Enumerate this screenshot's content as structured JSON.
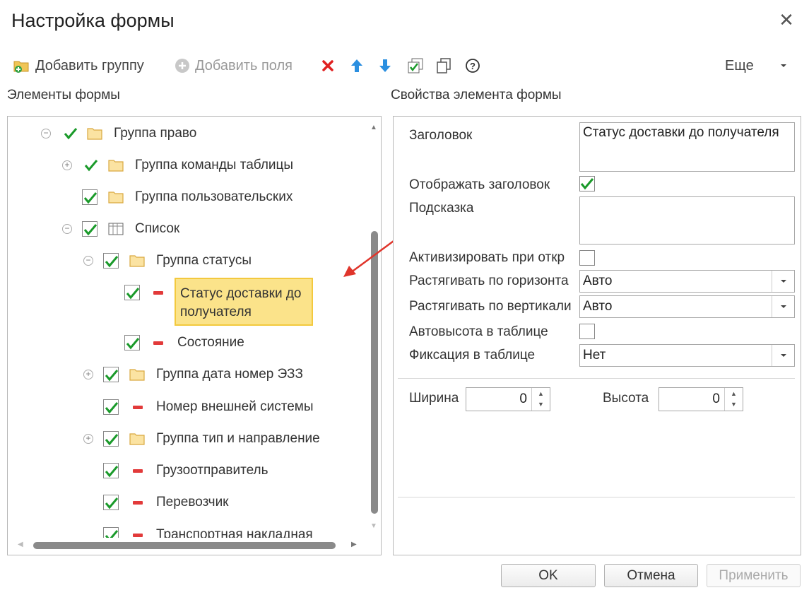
{
  "dialog": {
    "title": "Настройка формы"
  },
  "toolbar": {
    "add_group": "Добавить группу",
    "add_fields": "Добавить поля",
    "more": "Еще"
  },
  "left_panel": {
    "label": "Элементы формы"
  },
  "right_panel": {
    "label": "Свойства элемента формы"
  },
  "tree": {
    "items": [
      {
        "label": "Группа право",
        "checked": true,
        "type": "group",
        "expander": "collapse"
      },
      {
        "label": "Группа команды таблицы",
        "checked": true,
        "type": "group",
        "expander": "expand"
      },
      {
        "label": "Группа пользовательских",
        "checked": true,
        "type": "group"
      },
      {
        "label": "Список",
        "checked": true,
        "type": "table",
        "expander": "collapse"
      },
      {
        "label": "Группа статусы",
        "checked": true,
        "type": "group",
        "expander": "collapse"
      },
      {
        "label": "Статус доставки до получателя",
        "line1": "Статус доставки до",
        "line2": "получателя",
        "checked": true,
        "type": "field",
        "selected": true
      },
      {
        "label": "Состояние",
        "checked": true,
        "type": "field"
      },
      {
        "label": "Группа дата номер ЭЗЗ",
        "checked": true,
        "type": "group",
        "expander": "expand"
      },
      {
        "label": "Номер внешней системы",
        "checked": true,
        "type": "field"
      },
      {
        "label": "Группа тип и направление",
        "checked": true,
        "type": "group",
        "expander": "expand"
      },
      {
        "label": "Грузоотправитель",
        "checked": true,
        "type": "field"
      },
      {
        "label": "Перевозчик",
        "checked": true,
        "type": "field"
      },
      {
        "label": "Транспортная накладная",
        "checked": true,
        "type": "field"
      }
    ]
  },
  "properties": {
    "title_label": "Заголовок",
    "title_value": "Статус доставки до получателя",
    "show_title_label": "Отображать заголовок",
    "show_title_checked": true,
    "hint_label": "Подсказка",
    "hint_value": "",
    "activate_label": "Активизировать при откр",
    "activate_checked": false,
    "stretch_h_label": "Растягивать по горизонта",
    "stretch_h_value": "Авто",
    "stretch_v_label": "Растягивать по вертикали",
    "stretch_v_value": "Авто",
    "autoheight_label": "Автовысота в таблице",
    "autoheight_checked": false,
    "fix_label": "Фиксация в таблице",
    "fix_value": "Нет",
    "width_label": "Ширина",
    "width_value": "0",
    "height_label": "Высота",
    "height_value": "0"
  },
  "buttons": {
    "ok": "OK",
    "cancel": "Отмена",
    "apply": "Применить"
  },
  "colors": {
    "check_green": "#1a9a2a",
    "field_red": "#e23a3a",
    "folder_yellow": "#f0c557",
    "selection": "#fbe38a",
    "annotation_arrow": "#e0352b"
  }
}
